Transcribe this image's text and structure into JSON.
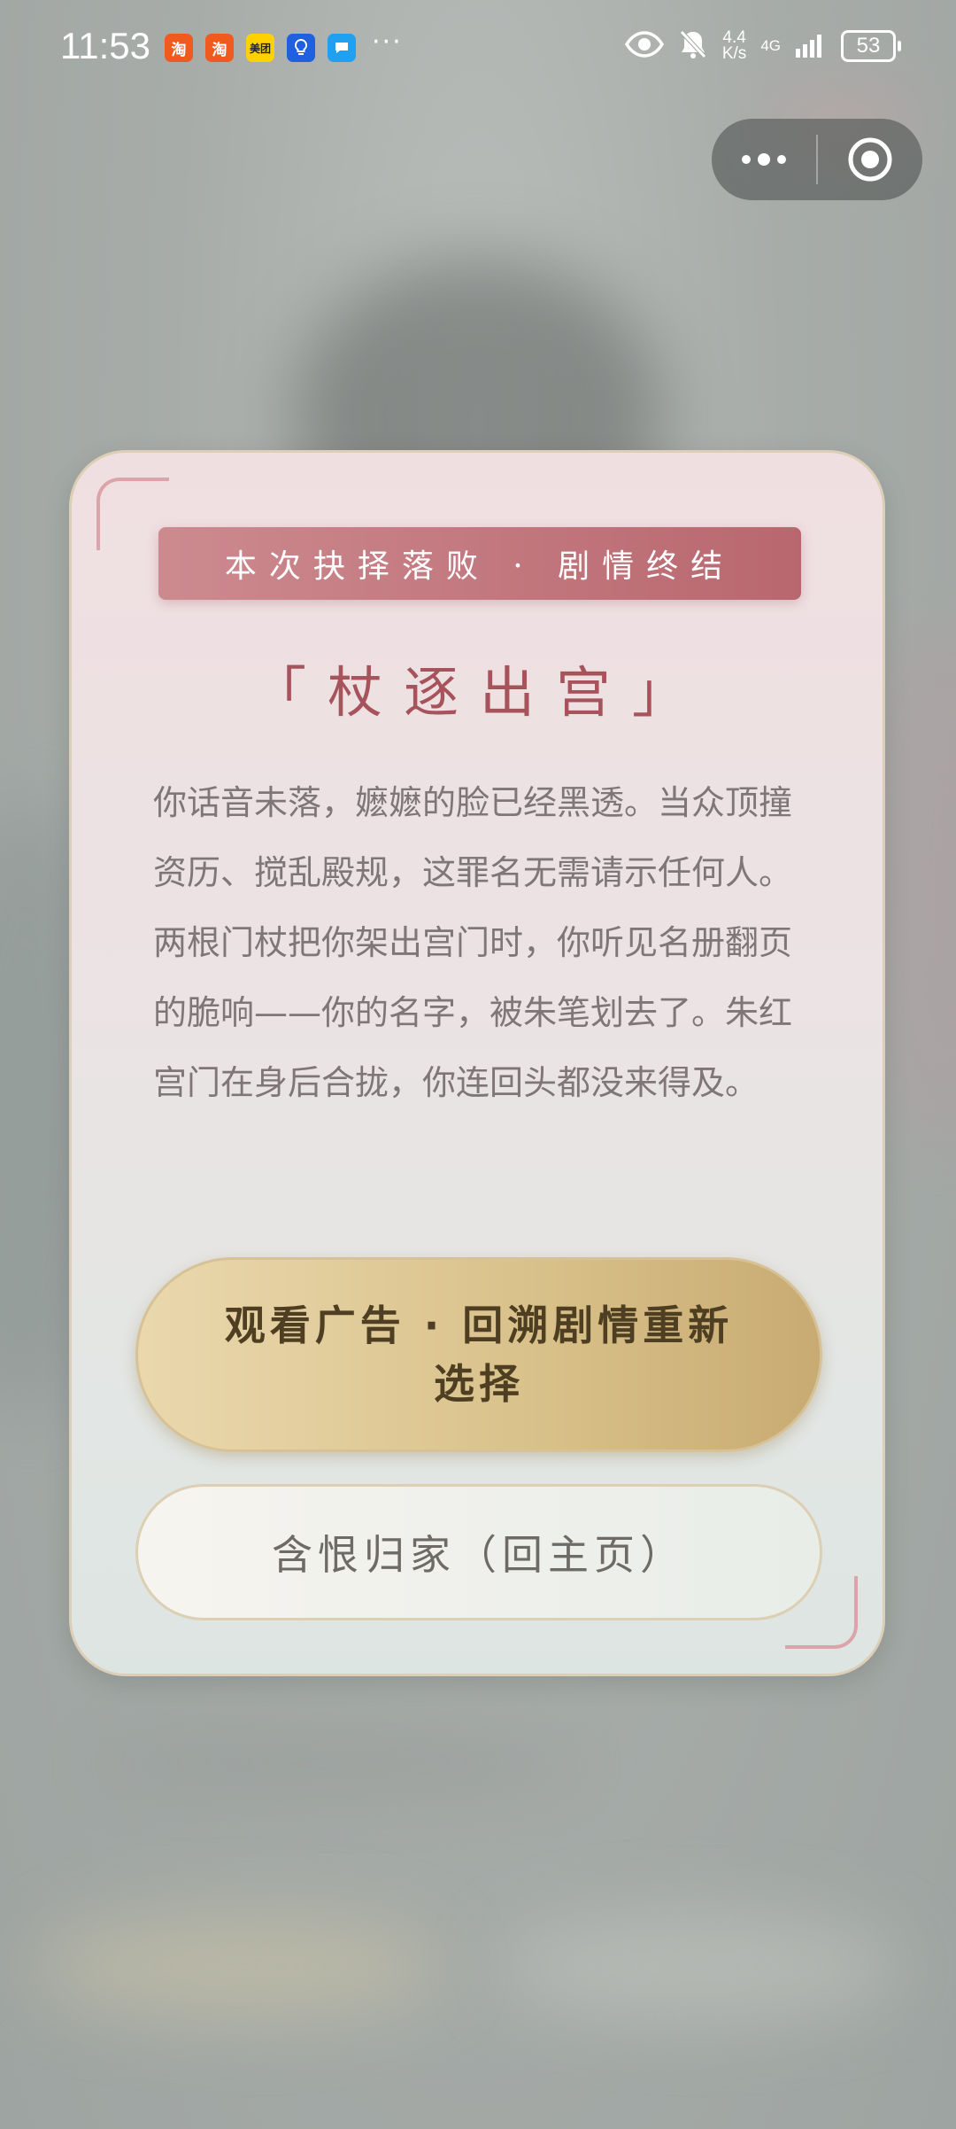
{
  "status_bar": {
    "time": "11:53",
    "app_icons": [
      {
        "icon": "taobao-icon",
        "label": "淘",
        "color": "#f05a1f"
      },
      {
        "icon": "taobao-icon",
        "label": "淘",
        "color": "#f05a1f"
      },
      {
        "icon": "meituan-icon",
        "label": "美团",
        "color": "#ffd100"
      },
      {
        "icon": "bulb-icon",
        "label": "",
        "color": "#1f5fe0"
      },
      {
        "icon": "chat-icon",
        "label": "",
        "color": "#1fa0f0"
      }
    ],
    "more": "···",
    "net_speed_value": "4.4",
    "net_speed_unit": "K/s",
    "network": "4G",
    "battery": "53"
  },
  "dialog": {
    "banner": "本次抉择落败 · 剧情终结",
    "title": "「杖逐出宫」",
    "story": "你话音未落，嬷嬷的脸已经黑透。当众顶撞资历、搅乱殿规，这罪名无需请示任何人。两根门杖把你架出宫门时，你听见名册翻页的脆响——你的名字，被朱笔划去了。朱红宫门在身后合拢，你连回头都没来得及。",
    "primary_button": "观看广告 · 回溯剧情重新选择",
    "secondary_button": "含恨归家（回主页）"
  },
  "colors": {
    "accent_red": "#b9676f",
    "gold": "#d8c089"
  }
}
